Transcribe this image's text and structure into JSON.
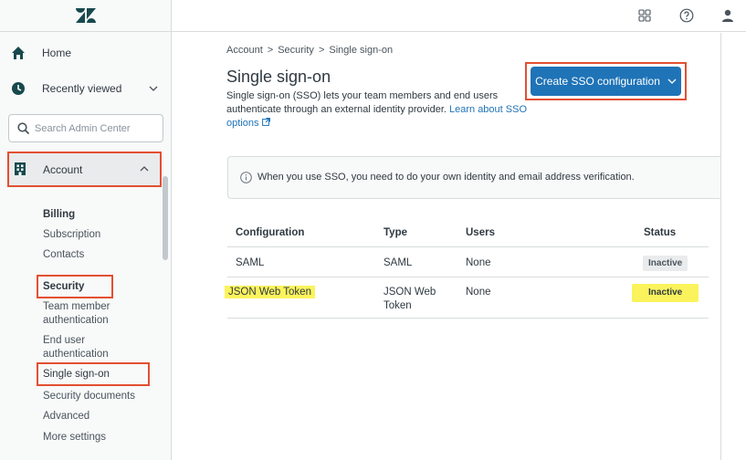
{
  "sidebar": {
    "logo": "Z",
    "home": "Home",
    "recently_viewed": "Recently viewed",
    "search_placeholder": "Search Admin Center",
    "account": "Account",
    "groups": {
      "billing_head": "Billing",
      "subscription": "Subscription",
      "contacts": "Contacts",
      "security_head": "Security",
      "team_auth": "Team member authentication",
      "end_user_auth": "End user authentication",
      "sso": "Single sign-on",
      "security_docs": "Security documents",
      "advanced": "Advanced",
      "more_settings": "More settings"
    }
  },
  "breadcrumb": [
    "Account",
    "Security",
    "Single sign-on"
  ],
  "breadcrumb_sep": ">",
  "page": {
    "title": "Single sign-on",
    "description": "Single sign-on (SSO) lets your team members and end users authenticate through an external identity provider.",
    "learn_more": "Learn about SSO options",
    "create_button": "Create SSO configuration",
    "notice": "When you use SSO, you need to do your own identity and email address verification."
  },
  "table": {
    "headers": [
      "Configuration",
      "Type",
      "Users",
      "Status"
    ],
    "rows": [
      {
        "configuration": "SAML",
        "type": "SAML",
        "users": "None",
        "status": "Inactive"
      },
      {
        "configuration": "JSON Web Token",
        "type": "JSON Web Token",
        "users": "None",
        "status": "Inactive"
      }
    ]
  },
  "icons": {
    "home": "home-icon",
    "recent": "clock-icon",
    "search": "search-icon",
    "account": "building-icon",
    "products": "grid-icon",
    "help": "help-icon",
    "profile": "user-icon",
    "info": "info-icon",
    "external": "external-link-icon"
  },
  "colors": {
    "accent": "#1f73b7",
    "highlight_box": "#e34f32",
    "highlighter": "#fbf35c",
    "brand": "#17494d"
  }
}
